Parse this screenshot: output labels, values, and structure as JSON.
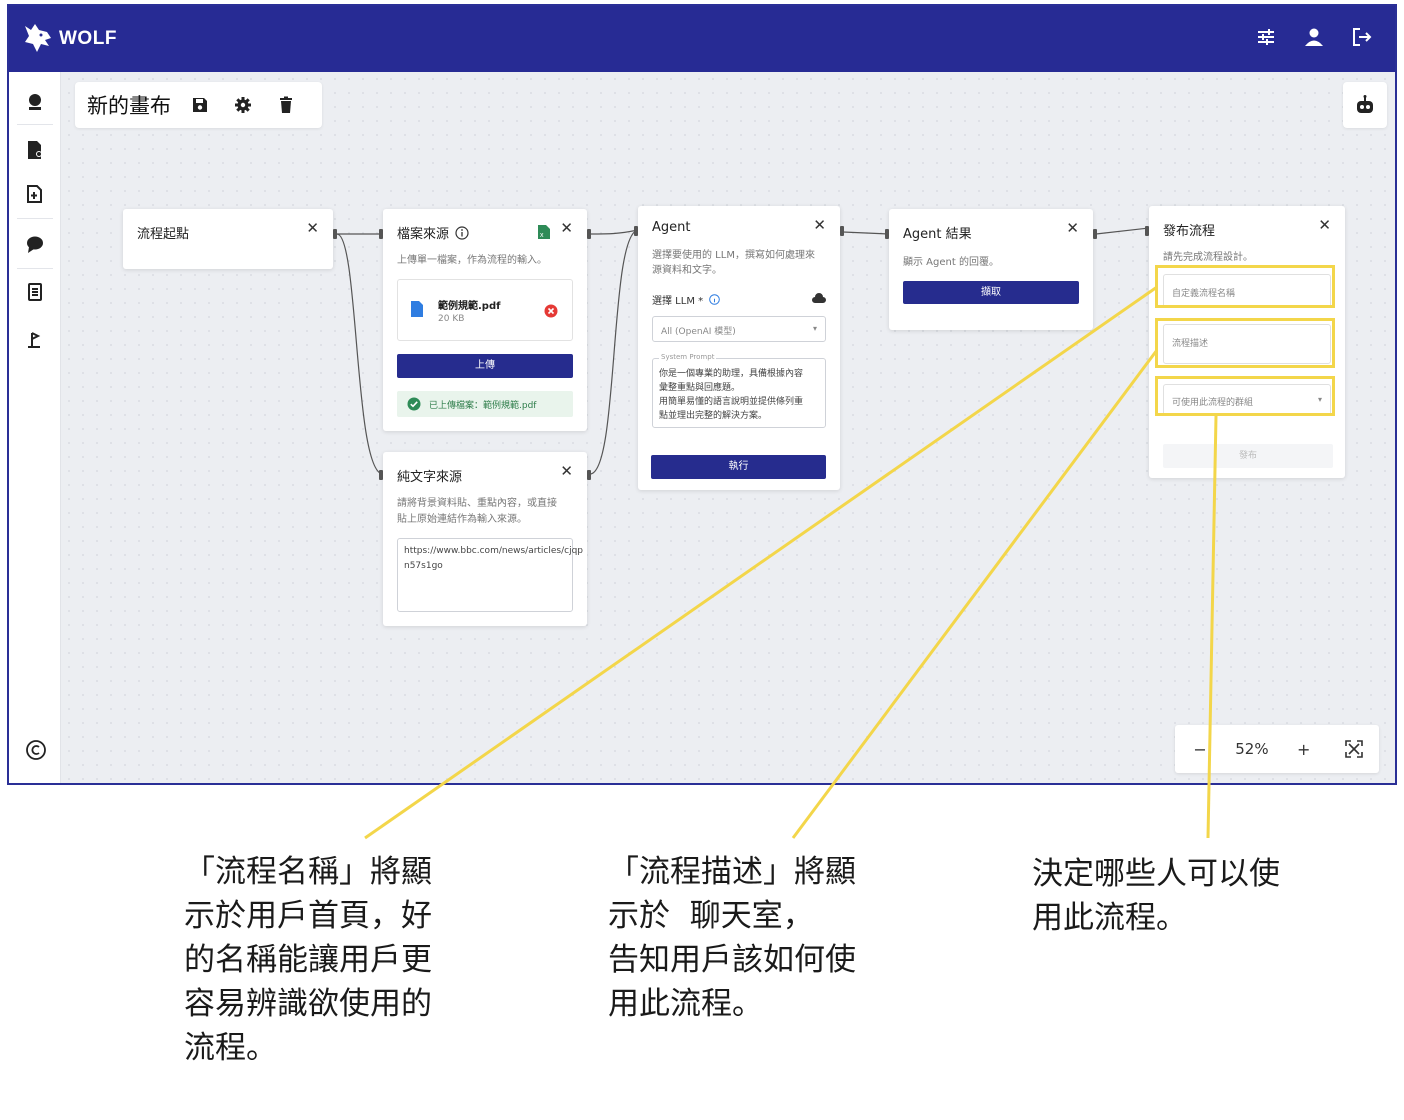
{
  "app": {
    "brand": "WOLF",
    "accent_color": "#272b94",
    "top_icons": [
      "sliders-icon",
      "user-icon",
      "logout-icon"
    ],
    "sidebar_icons": [
      "person-icon",
      "file-person-icon",
      "file-add-icon",
      "chat-icon",
      "document-list-icon",
      "flag-icon"
    ]
  },
  "canvas": {
    "title": "新的畫布",
    "zoom": "52%",
    "zoom_out": "−",
    "zoom_in": "+"
  },
  "nodes": {
    "start": {
      "title": "流程起點",
      "close": "✕"
    },
    "file_source": {
      "title": "檔案來源",
      "close": "✕",
      "description": "上傳單一檔案，作為流程的輸入。",
      "file_name": "範例規範.pdf",
      "file_size": "20 KB",
      "upload_label": "上傳",
      "uploaded_msg": "已上傳檔案：範例規範.pdf"
    },
    "text_source": {
      "title": "純文字來源",
      "close": "✕",
      "description_line1": "請將背景資料貼、重點內容，或直接",
      "description_line2": "貼上原始連結作為輸入來源。",
      "value_line1": "https://www.bbc.com/news/articles/cjqp",
      "value_line2": "n57s1go"
    },
    "agent": {
      "title": "Agent",
      "close": "✕",
      "description_line1": "選擇要使用的 LLM，撰寫如何處理來",
      "description_line2": "源資料和文字。",
      "llm_label": "選擇 LLM *",
      "llm_value": "All (OpenAI 模型)",
      "prompt_label": "System Prompt",
      "prompt_line1": "你是一個專業的助理，具備根據內容",
      "prompt_line2": "彙整重點與回應題。",
      "prompt_line3": "用簡單易懂的語言說明並提供條列重",
      "prompt_line4": "點並理出完整的解決方案。",
      "run_label": "執行"
    },
    "agent_result": {
      "title": "Agent 結果",
      "close": "✕",
      "description": "顯示 Agent 的回覆。",
      "fetch_label": "擷取"
    },
    "publish": {
      "title": "發布流程",
      "close": "✕",
      "description": "請先完成流程設計。",
      "name_placeholder": "自定義流程名稱",
      "desc_placeholder": "流程描述",
      "group_placeholder": "可使用此流程的群組",
      "publish_label": "發布"
    }
  },
  "annotations": {
    "name_note": "「流程名稱」將顯\n示於用戶首頁，好\n的名稱能讓用戶更\n容易辨識欲使用的\n流程。",
    "desc_note": "「流程描述」將顯\n示於  聊天室，\n告知用戶該如何使\n用此流程。",
    "group_note": "決定哪些人可以使\n用此流程。"
  }
}
